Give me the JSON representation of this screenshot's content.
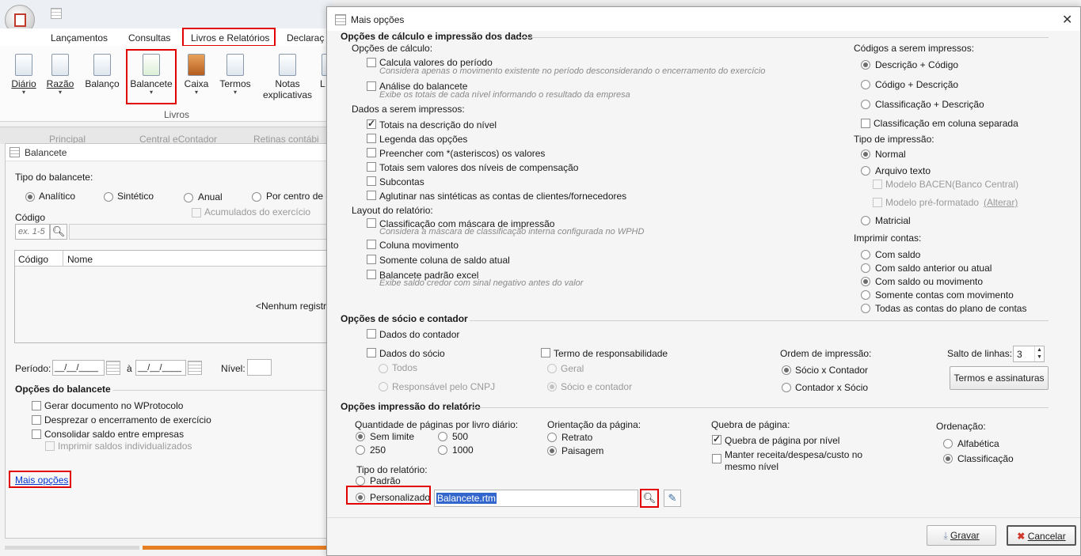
{
  "app": {
    "menu": [
      "Lançamentos",
      "Consultas",
      "Livros e Relatórios",
      "Declaraç"
    ],
    "ribbon": {
      "items": [
        {
          "label": "Diário"
        },
        {
          "label": "Razão"
        },
        {
          "label": "Balanço"
        },
        {
          "label": "Balancete"
        },
        {
          "label": "Caixa"
        },
        {
          "label": "Termos"
        },
        {
          "label": "Notas",
          "label2": "explicativas"
        },
        {
          "label": "L"
        }
      ],
      "group": "Livros"
    },
    "tabs": [
      "Principal",
      "Central eContador",
      "Retinas contábi"
    ]
  },
  "balancete": {
    "title": "Balancete",
    "tipo_label": "Tipo do balancete:",
    "tipos": [
      "Analítico",
      "Sintético",
      "Anual",
      "Por centro de c"
    ],
    "acumulados": "Acumulados do exercício",
    "codigo_label": "Código",
    "codigo_placeholder": "ex. 1-5",
    "col_codigo": "Código",
    "col_nome": "Nome",
    "empty": "<Nenhum registr",
    "periodo_label": "Período:",
    "periodo_mask": "__/__/____",
    "a_label": "à",
    "nivel_label": "Nível:",
    "opcoes_title": "Opções do balancete",
    "opcoes": [
      "Gerar documento no WProtocolo",
      "Desprezar o encerramento de exercício",
      "Consolidar saldo entre empresas"
    ],
    "imprimir_saldos": "Imprimir saldos individualizados",
    "mais_opcoes": "Mais opções"
  },
  "dialog": {
    "title": "Mais opções",
    "calc_section": "Opções de cálculo e impressão dos dados",
    "opc_calculo": "Opções de cálculo:",
    "calcula": "Calcula valores do período",
    "calcula_hint": "Considera apenas o movimento existente no período desconsiderando o encerramento do exercício",
    "analise": "Análise do balancete",
    "analise_hint": "Exibe os totais de cada nível informando o resultado da empresa",
    "dados_impressos": "Dados a serem impressos:",
    "dados": [
      "Totais na descrição do nível",
      "Legenda das opções",
      "Preencher com *(asteriscos) os valores",
      "Totais sem valores dos níveis de compensação",
      "Subcontas",
      "Aglutinar nas sintéticas as contas de clientes/fornecedores"
    ],
    "layout_label": "Layout do relatório:",
    "mascara": "Classificação com máscara de impressão",
    "mascara_hint": "Considera a máscara de classificação interna configurada no WPHD",
    "coluna_mov": "Coluna movimento",
    "coluna_saldo": "Somente coluna de saldo atual",
    "padrao_excel": "Balancete padrão excel",
    "padrao_excel_hint": "Exibe saldo credor com sinal negativo antes do valor",
    "codigos_label": "Códigos a serem impressos:",
    "codigos": [
      "Descrição + Código",
      "Código + Descrição",
      "Classificação + Descrição"
    ],
    "class_coluna": "Classificação em coluna separada",
    "tipo_impressao": "Tipo de impressão:",
    "normal": "Normal",
    "arquivo": "Arquivo texto",
    "bacen": "Modelo BACEN(Banco Central)",
    "preformatado": "Modelo pré-formatado",
    "alterar": "(Alterar)",
    "matricial": "Matricial",
    "imprimir_contas": "Imprimir contas:",
    "contas": [
      "Com saldo",
      "Com saldo anterior ou atual",
      "Com saldo ou movimento",
      "Somente contas com movimento",
      "Todas as contas do plano de contas"
    ],
    "socio_section": "Opções de sócio e contador",
    "dados_contador": "Dados do contador",
    "dados_socio": "Dados do sócio",
    "todos": "Todos",
    "resp_cnpj": "Responsável pelo CNPJ",
    "termo": "Termo de responsabilidade",
    "geral": "Geral",
    "socio_contador": "Sócio e contador",
    "ordem_impressao": "Ordem de impressão:",
    "ordem": [
      "Sócio x Contador",
      "Contador x Sócio"
    ],
    "salto": "Salto de linhas:",
    "salto_val": "3",
    "termos_btn": "Termos e assinaturas",
    "impressao_section": "Opções impressão do relatório",
    "qtd_paginas": "Quantidade de páginas por livro diário:",
    "paginas": [
      "Sem limite",
      "500",
      "250",
      "1000"
    ],
    "orientacao": "Orientação da página:",
    "orient": [
      "Retrato",
      "Paisagem"
    ],
    "quebra": "Quebra de página:",
    "quebra_nivel": "Quebra de página por nível",
    "manter": "Manter receita/despesa/custo no",
    "manter2": "mesmo nível",
    "ordenacao": "Ordenação:",
    "ordem_opts": [
      "Alfabética",
      "Classificação"
    ],
    "tipo_relatorio": "Tipo do relatório:",
    "padrao": "Padrão",
    "personalizado": "Personalizado",
    "arquivo_rtm": "Balancete.rtm",
    "gravar": "Gravar",
    "cancelar": "Cancelar"
  }
}
